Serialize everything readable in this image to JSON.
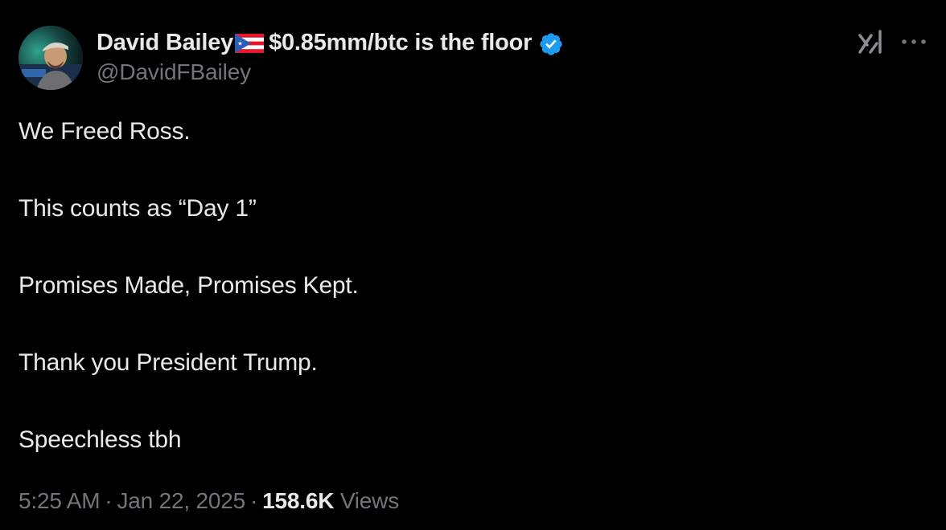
{
  "author": {
    "display_name": "David Bailey",
    "name_suffix": "$0.85mm/btc is the floor",
    "handle": "@DavidFBailey",
    "flag_icon": "puerto-rico-flag-icon",
    "verified_icon": "verified-badge-icon",
    "verified_color": "#1d9bf0"
  },
  "header_actions": {
    "grok_icon": "grok-icon",
    "more_icon": "more-horizontal-icon"
  },
  "tweet": {
    "lines": [
      "We Freed Ross.",
      "This counts as “Day 1”",
      "Promises Made, Promises Kept.",
      "Thank you President Trump.",
      "Speechless tbh"
    ]
  },
  "meta": {
    "time": "5:25 AM",
    "separator": "·",
    "date": "Jan 22, 2025",
    "views_count": "158.6K",
    "views_label": "Views"
  },
  "colors": {
    "background": "#000000",
    "primary_text": "#e7e9ea",
    "secondary_text": "#71767b",
    "accent": "#1d9bf0"
  }
}
